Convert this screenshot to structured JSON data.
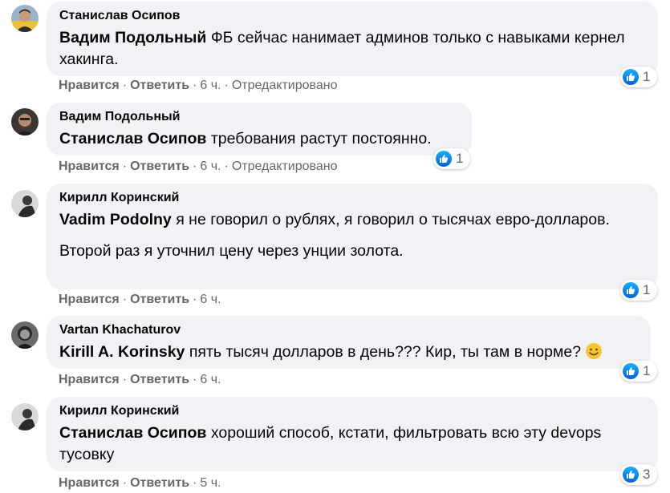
{
  "comments": [
    {
      "author": "Станислав Осипов",
      "mention": "Вадим Подольный",
      "text": "ФБ сейчас нанимает админов только с навыками кернел хакинга.",
      "like": "Нравится",
      "reply": "Ответить",
      "time": "6 ч.",
      "edited": "Отредактировано",
      "reactions": "1"
    },
    {
      "author": "Вадим Подольный",
      "mention": "Станислав Осипов",
      "text": "требования растут постоянно.",
      "like": "Нравится",
      "reply": "Ответить",
      "time": "6 ч.",
      "edited": "Отредактировано",
      "reactions": "1"
    },
    {
      "author": "Кирилл Коринский",
      "mention": "Vadim Podolny",
      "text": "я не говорил о рублях, я говорил о тысячах евро-долларов.",
      "text2": "Второй раз я уточнил цену через унции золота.",
      "like": "Нравится",
      "reply": "Ответить",
      "time": "6 ч.",
      "reactions": "1"
    },
    {
      "author": "Vartan Khachaturov",
      "mention": "Kirill A. Korinsky",
      "text": "пять тысяч долларов в день??? Кир, ты там в норме?",
      "like": "Нравится",
      "reply": "Ответить",
      "time": "6 ч.",
      "reactions": "1"
    },
    {
      "author": "Кирилл Коринский",
      "mention": "Станислав Осипов",
      "text": "хороший способ, кстати, фильтровать всю эту devops тусовку",
      "like": "Нравится",
      "reply": "Ответить",
      "time": "5 ч.",
      "reactions": "3"
    }
  ],
  "icons": {
    "like": "like-icon",
    "emoji": "smiling-face-emoji"
  },
  "colors": {
    "bubble": "#f0f2f5",
    "meta": "#65676b",
    "like_blue": "#1877f2"
  }
}
